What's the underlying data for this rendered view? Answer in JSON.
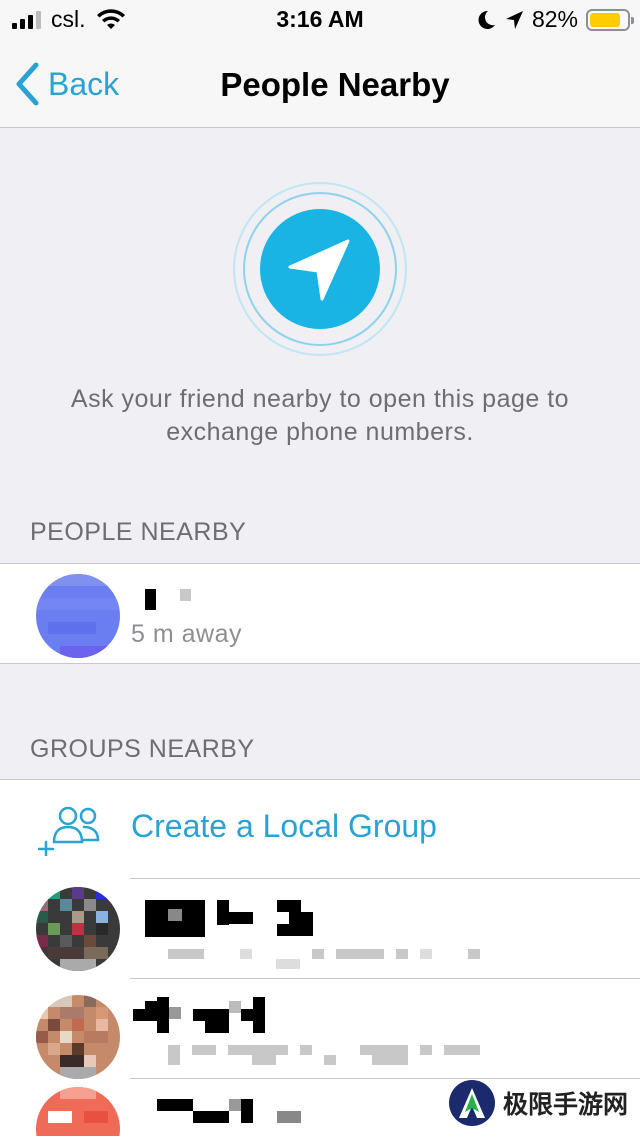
{
  "status_bar": {
    "carrier": "csl.",
    "time": "3:16 AM",
    "battery_percent": "82%",
    "battery_level": 0.82
  },
  "nav": {
    "back_label": "Back",
    "title": "People Nearby"
  },
  "hero": {
    "icon": "location-arrow-icon",
    "description": "Ask your friend nearby to open this page to exchange phone numbers."
  },
  "people_section": {
    "header": "PEOPLE NEARBY",
    "items": [
      {
        "distance": "5 m away"
      }
    ]
  },
  "groups_section": {
    "header": "GROUPS NEARBY",
    "create_label": "Create a Local Group"
  },
  "watermark": {
    "text": "极限手游网"
  },
  "colors": {
    "accent": "#2aa3d4",
    "background": "#efeff4",
    "battery": "#ffcc00"
  }
}
